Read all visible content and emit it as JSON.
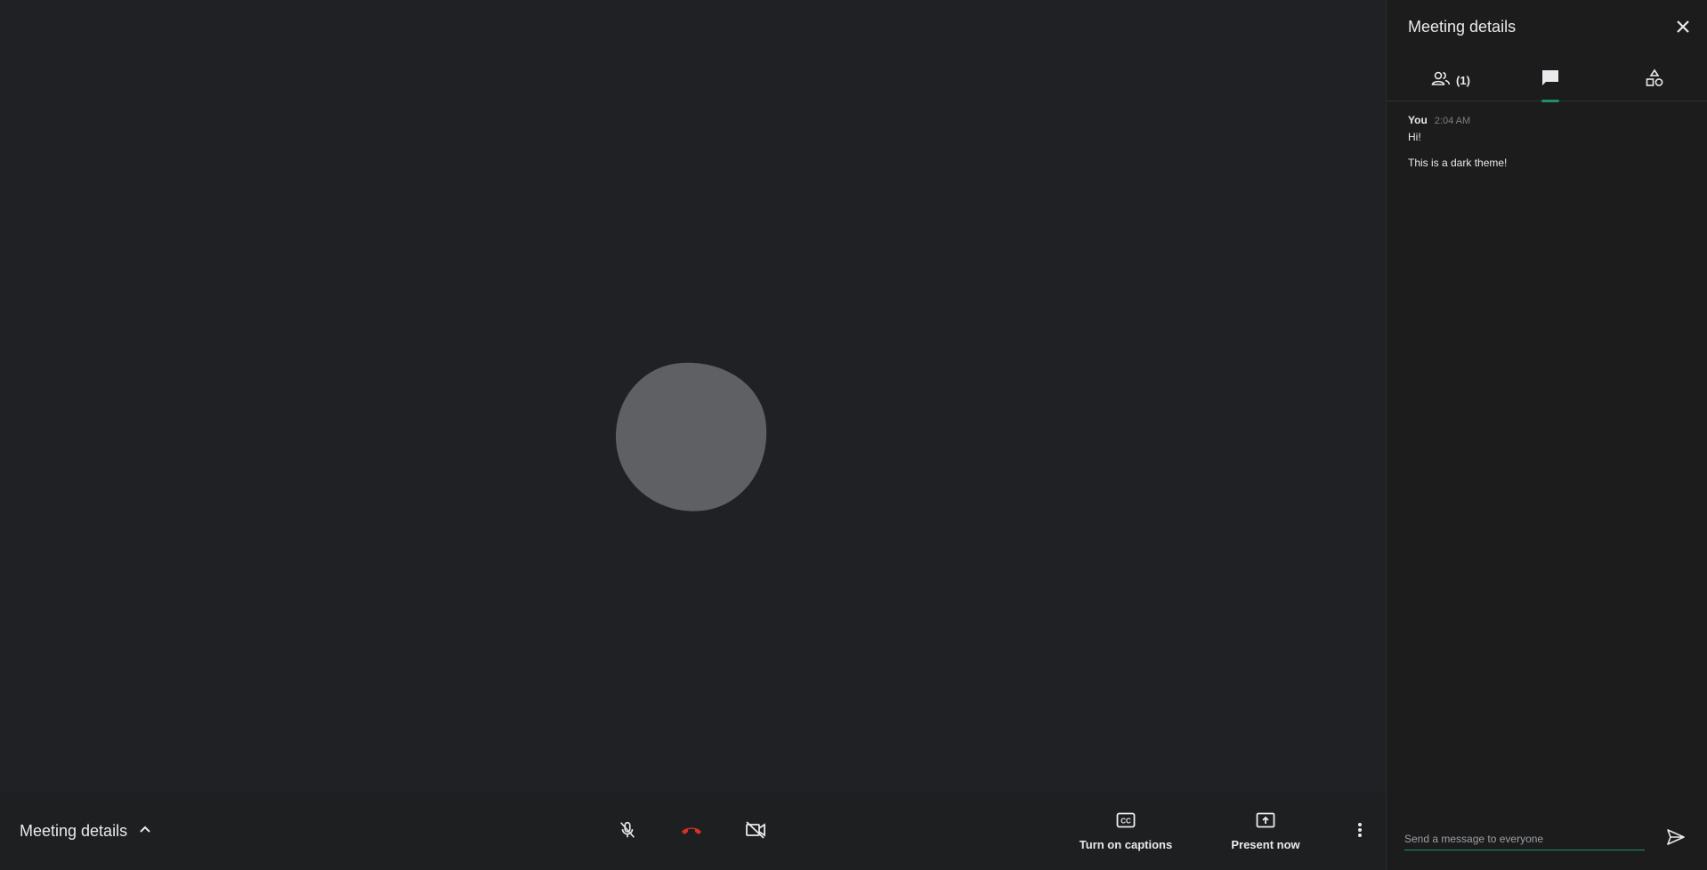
{
  "bottom_bar": {
    "meeting_details_label": "Meeting details",
    "captions_label": "Turn on captions",
    "present_label": "Present now"
  },
  "panel": {
    "title": "Meeting details",
    "people_count": "(1)",
    "messages": [
      {
        "author": "You",
        "time": "2:04 AM",
        "lines": [
          "Hi!",
          "This is a dark theme!"
        ]
      }
    ],
    "compose_placeholder": "Send a message to everyone"
  },
  "colors": {
    "background": "#202124",
    "panel_background": "#1c1c1c",
    "accent": "#1e8e6e",
    "hangup": "#d93025",
    "avatar": "#5f6063"
  },
  "icons": {
    "mic": "mic-off-icon",
    "hangup": "call-end-icon",
    "camera": "videocam-off-icon",
    "captions": "closed-caption-icon",
    "present": "present-to-all-icon",
    "more": "more-vert-icon",
    "close": "close-icon",
    "people": "people-icon",
    "chat": "chat-icon",
    "activities": "activities-icon",
    "send": "send-icon"
  }
}
